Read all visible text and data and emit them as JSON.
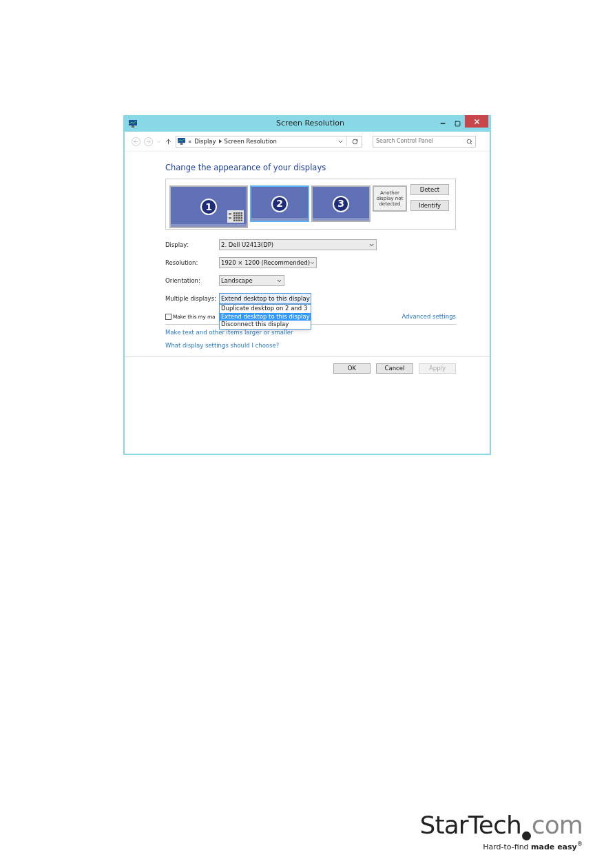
{
  "window": {
    "title": "Screen Resolution"
  },
  "address_bar": {
    "breadcrumb": [
      "«",
      "Display",
      "Screen Resolution"
    ],
    "search": {
      "placeholder": "Search Control Panel"
    }
  },
  "heading": "Change the appearance of your displays",
  "monitors": [
    {
      "kind": "main",
      "label": "1",
      "selected": false
    },
    {
      "kind": "secondary",
      "label": "2",
      "selected": true
    },
    {
      "kind": "secondary",
      "label": "3",
      "selected": false
    },
    {
      "kind": "undetected",
      "label": "Another display not detected",
      "selected": false
    }
  ],
  "side_buttons": [
    "Detect",
    "Identify"
  ],
  "settings": [
    {
      "label": "Display:",
      "value": "2. Dell U2413(DP)",
      "expanded": false
    },
    {
      "label": "Resolution:",
      "value": "1920 × 1200 (Recommended)",
      "expanded": false
    },
    {
      "label": "Orientation:",
      "value": "Landscape",
      "expanded": false
    },
    {
      "label": "Multiple displays:",
      "value": "Extend desktop to this display",
      "expanded": true,
      "options": [
        {
          "label": "Duplicate desktop on 2 and 3",
          "selected": false
        },
        {
          "label": "Extend desktop to this display",
          "selected": true
        },
        {
          "label": "Disconnect this display",
          "selected": false
        }
      ]
    }
  ],
  "main_display_checkbox": {
    "label": "Make this my ma",
    "checked": false
  },
  "advanced_link": "Advanced settings",
  "links": [
    "Make text and other items larger or smaller",
    "What display settings should I choose?"
  ],
  "footer_buttons": [
    {
      "label": "OK",
      "disabled": false
    },
    {
      "label": "Cancel",
      "disabled": false
    },
    {
      "label": "Apply",
      "disabled": true
    }
  ],
  "logo": {
    "name": "StarTech",
    "suffix": "com",
    "tagline": "Hard-to-find **made easy**$^{®}$"
  }
}
